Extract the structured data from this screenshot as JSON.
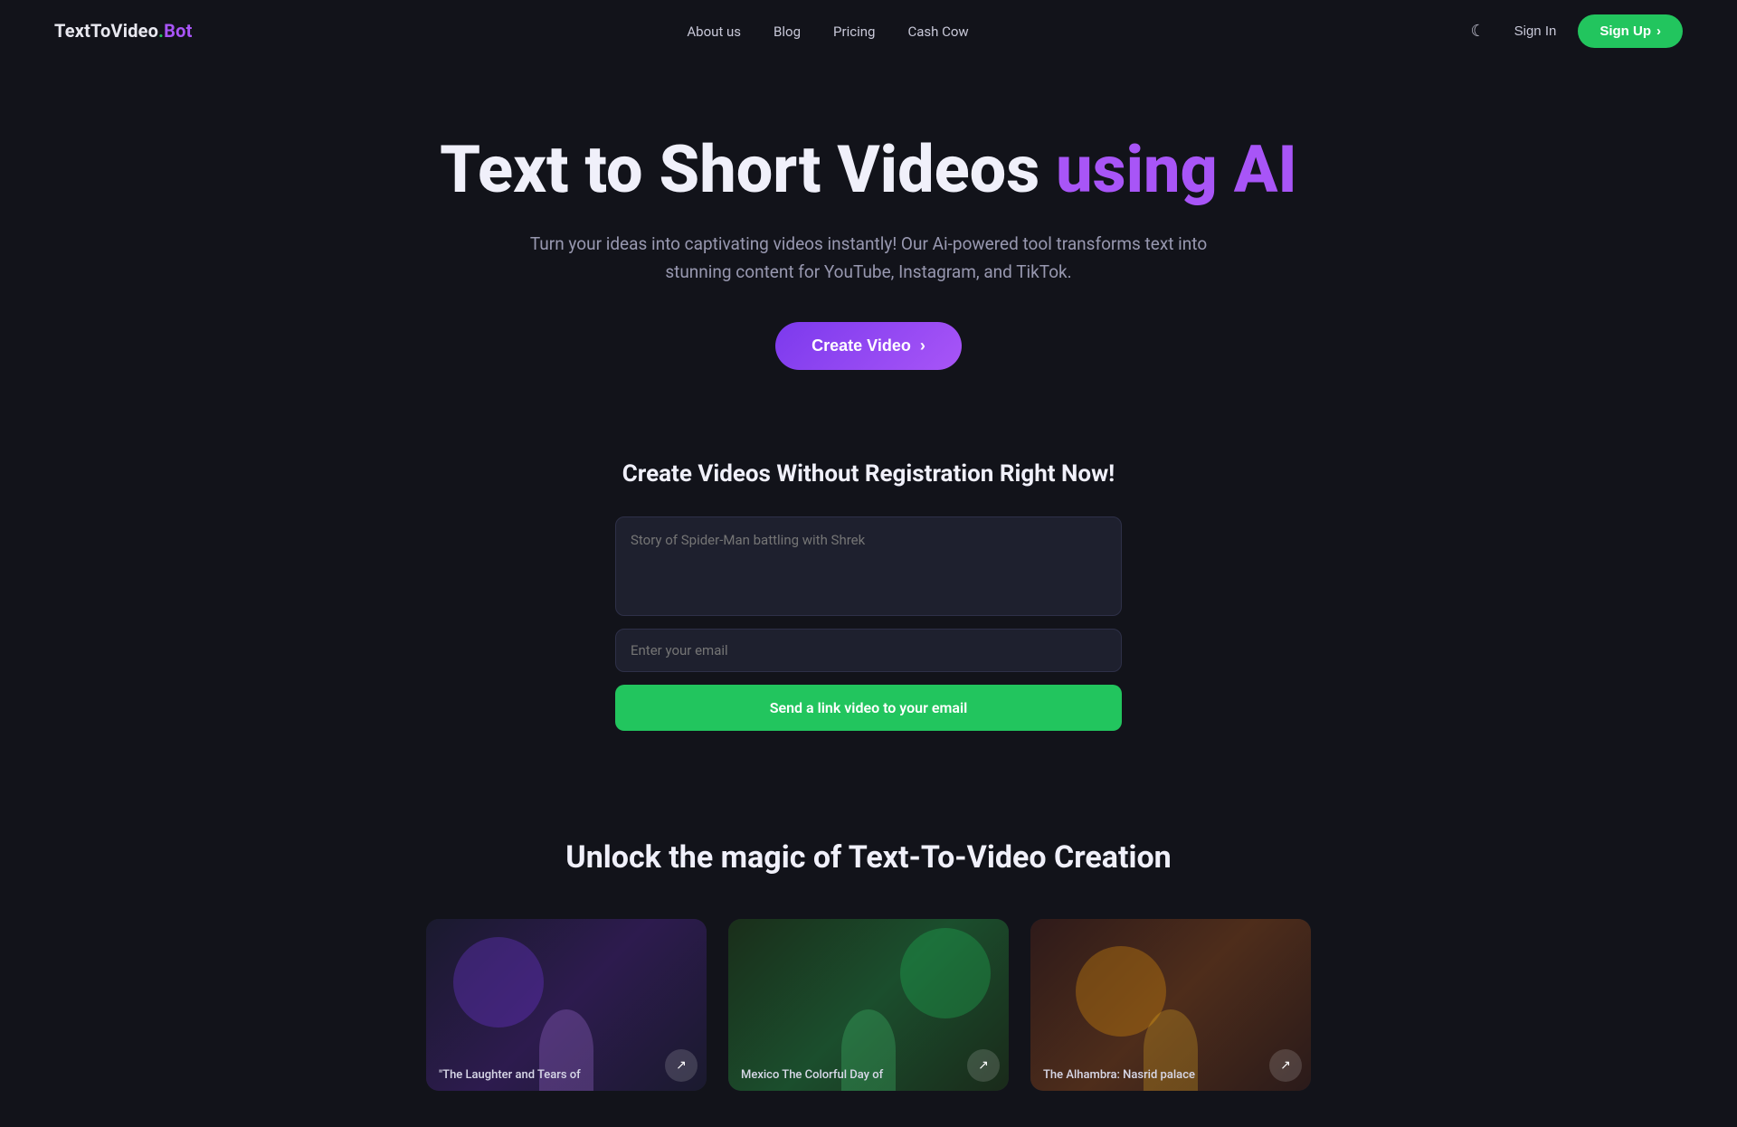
{
  "nav": {
    "logo": {
      "text_before": "TextToVideo",
      "dot": ".",
      "text_after": "Bot"
    },
    "links": [
      {
        "label": "About us",
        "id": "about-us"
      },
      {
        "label": "Blog",
        "id": "blog"
      },
      {
        "label": "Pricing",
        "id": "pricing"
      },
      {
        "label": "Cash Cow",
        "id": "cash-cow"
      }
    ],
    "dark_mode_icon": "☾",
    "sign_in_label": "Sign In",
    "sign_up_label": "Sign Up",
    "sign_up_arrow": "›"
  },
  "hero": {
    "heading_part1": "Text to Short Videos ",
    "heading_highlight": "using AI",
    "subtext": "Turn your ideas into captivating videos instantly! Our Ai-powered tool transforms text into stunning content for YouTube, Instagram, and TikTok.",
    "create_button_label": "Create Video",
    "create_button_arrow": "›"
  },
  "form_section": {
    "heading": "Create Videos Without Registration Right Now!",
    "textarea_placeholder": "Story of Spider-Man battling with Shrek",
    "email_placeholder": "Enter your email",
    "submit_label": "Send a link video to your email"
  },
  "magic_section": {
    "heading": "Unlock the magic of Text-To-Video Creation",
    "cards": [
      {
        "label": "\"The Laughter and Tears of",
        "id": "card-1"
      },
      {
        "label": "Mexico The Colorful Day of",
        "id": "card-2"
      },
      {
        "label": "The Alhambra: Nasrid palace",
        "id": "card-3"
      }
    ],
    "share_icon": "↗"
  }
}
